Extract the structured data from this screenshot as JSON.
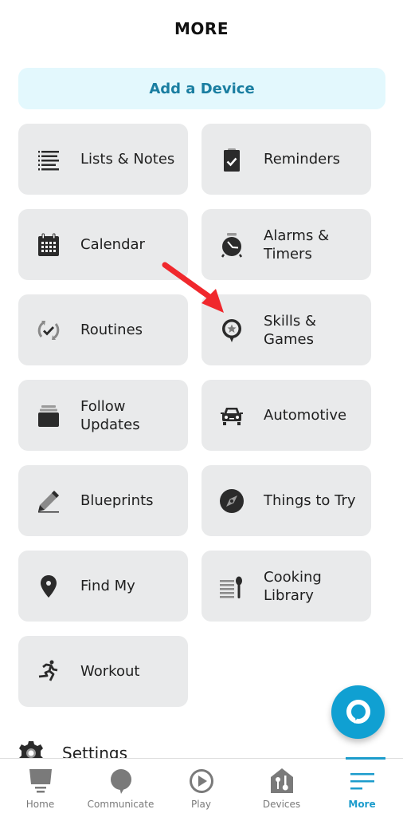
{
  "header": {
    "title": "MORE"
  },
  "add_device": {
    "label": "Add a Device"
  },
  "colors": {
    "accent": "#1c9ccc",
    "add_device_bg": "#e3f8fd",
    "add_device_text": "#1a7ea1",
    "card_bg": "#e9eaeb",
    "fab_bg": "#10a0d2",
    "annotation_arrow": "#f0282d"
  },
  "cards": [
    {
      "label": "Lists & Notes",
      "icon": "list-icon"
    },
    {
      "label": "Reminders",
      "icon": "clipboard-check-icon"
    },
    {
      "label": "Calendar",
      "icon": "calendar-icon"
    },
    {
      "label": "Alarms & Timers",
      "icon": "alarm-clock-icon"
    },
    {
      "label": "Routines",
      "icon": "routines-icon"
    },
    {
      "label": "Skills & Games",
      "icon": "skills-star-icon"
    },
    {
      "label": "Follow Updates",
      "icon": "stack-icon"
    },
    {
      "label": "Automotive",
      "icon": "car-icon"
    },
    {
      "label": "Blueprints",
      "icon": "pencil-icon"
    },
    {
      "label": "Things to Try",
      "icon": "compass-icon"
    },
    {
      "label": "Find My",
      "icon": "location-pin-icon"
    },
    {
      "label": "Cooking Library",
      "icon": "cooking-spoon-icon"
    },
    {
      "label": "Workout",
      "icon": "running-icon"
    }
  ],
  "settings": {
    "label": "Settings"
  },
  "nav": {
    "items": [
      {
        "label": "Home",
        "icon": "home-icon",
        "active": false
      },
      {
        "label": "Communicate",
        "icon": "chat-bubble-icon",
        "active": false
      },
      {
        "label": "Play",
        "icon": "play-icon",
        "active": false
      },
      {
        "label": "Devices",
        "icon": "devices-house-icon",
        "active": false
      },
      {
        "label": "More",
        "icon": "menu-lines-icon",
        "active": true
      }
    ]
  }
}
